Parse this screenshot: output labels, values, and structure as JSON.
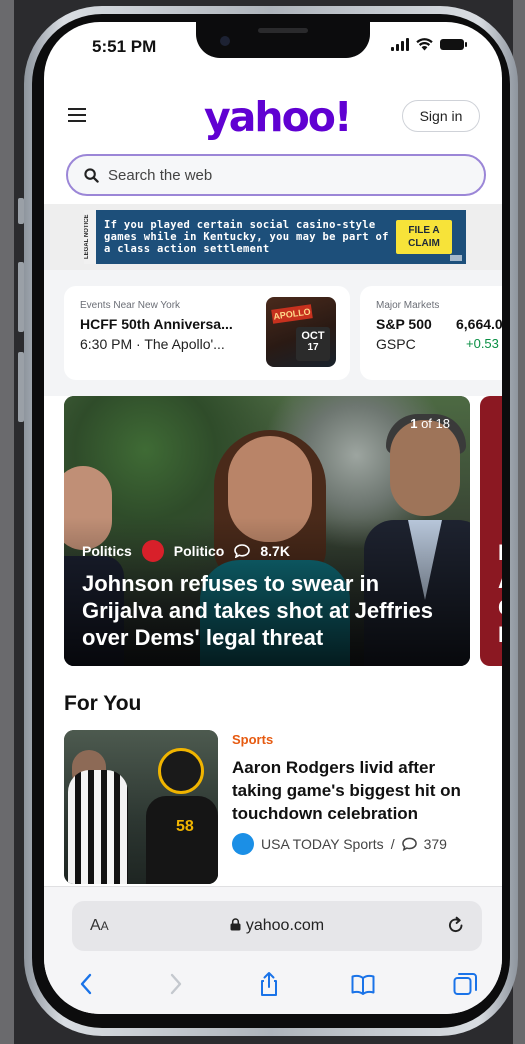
{
  "status_bar": {
    "time": "5:51 PM"
  },
  "header": {
    "logo": "yahoo!",
    "sign_in": "Sign in"
  },
  "search": {
    "placeholder": "Search the web"
  },
  "ad": {
    "tag": "LEGAL NOTICE",
    "text": "If you played certain social casino-style games while in Kentucky, you may be part of a class action settlement",
    "cta": "FILE A CLAIM"
  },
  "event_card": {
    "kicker": "Events Near New York",
    "title": "HCFF 50th Anniversa...",
    "time": "6:30 PM · The Apollo'...",
    "thumb_sign": "APOLLO",
    "month": "OCT",
    "day": "17"
  },
  "markets_card": {
    "kicker": "Major Markets",
    "name": "S&P 500",
    "symbol": "GSPC",
    "value": "6,664.0",
    "change": "+0.53"
  },
  "hero": {
    "counter_current": "1",
    "counter_rest": "of 18",
    "category": "Politics",
    "source": "Politico",
    "comments": "8.7K",
    "title": "Johnson refuses to swear in Grijalva and takes shot at Jeffries over Dems' legal threat"
  },
  "hero_peek": {
    "letters": [
      "P",
      "A",
      "C",
      "H"
    ]
  },
  "for_you": {
    "title": "For You",
    "story": {
      "category": "Sports",
      "title": "Aaron Rodgers livid after taking game's biggest hit on touchdown celebration",
      "source": "USA TODAY Sports",
      "separator": "/",
      "comments": "379",
      "jersey_number": "58"
    }
  },
  "safari": {
    "aa_large": "A",
    "aa_small": "A",
    "url": "yahoo.com"
  },
  "icons": {
    "menu": "hamburger-icon",
    "search": "magnifier-icon",
    "lock": "lock-icon",
    "reload": "reload-icon",
    "back": "chevron-left-icon",
    "forward": "chevron-right-icon",
    "share": "share-icon",
    "bookmarks": "book-icon",
    "tabs": "tabs-icon"
  },
  "colors": {
    "brand": "#6001d2",
    "search_border": "#9b86d7",
    "sports": "#e65a10",
    "positive": "#0a8f44",
    "ios_blue": "#1a73e8"
  }
}
